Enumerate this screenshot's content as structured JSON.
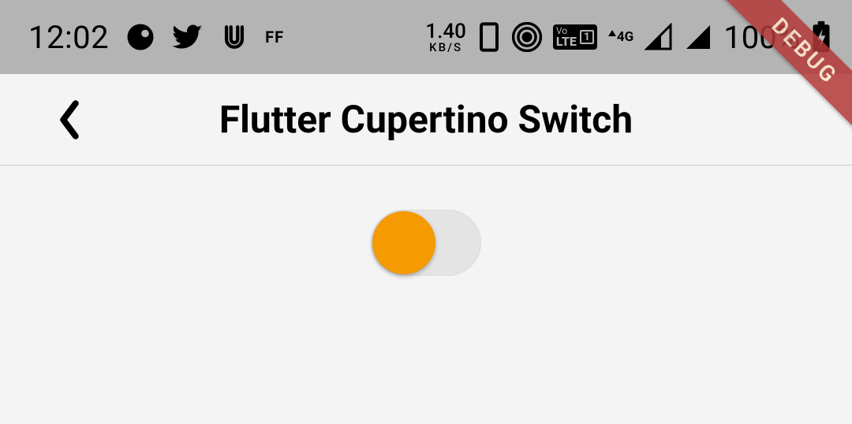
{
  "status_bar": {
    "time": "12:02",
    "ff_label": "FF",
    "net_speed_value": "1.40",
    "net_speed_unit": "KB/S",
    "net_type": "4G",
    "volte_vo": "Vo",
    "volte_lte": "LTE",
    "volte_slot": "1",
    "battery_pct": "100%"
  },
  "nav": {
    "title": "Flutter Cupertino Switch"
  },
  "switch": {
    "value": false,
    "thumb_color": "#f59a00",
    "track_color_off": "#e4e4e4"
  },
  "debug_banner": "DEBUG"
}
